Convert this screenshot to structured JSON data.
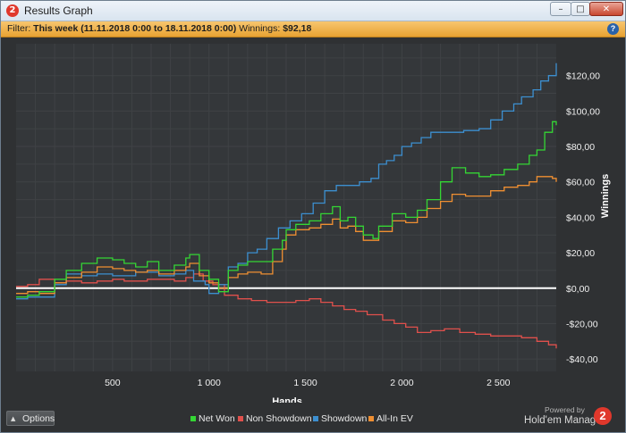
{
  "window": {
    "app_icon_glyph": "2",
    "title": "Results Graph",
    "controls": {
      "minimize": "–",
      "maximize": "□",
      "close": "✕"
    }
  },
  "filter": {
    "prefix": "Filter: ",
    "range": "This week (11.11.2018 0:00 to 18.11.2018 0:00)",
    "winnings_label": "  Winnings: ",
    "winnings_value": "$92,18",
    "help_icon": "?"
  },
  "colors": {
    "net_won": "#34d634",
    "non_showdown": "#e0504c",
    "showdown": "#3c8fd0",
    "all_in_ev": "#ef8f32",
    "zero_line": "#ffffff",
    "plot_bg": "#34373a",
    "filter_bar": "#f2b448"
  },
  "footer": {
    "options_caret": "▲",
    "options_label": "Options",
    "powered_by": "Powered by",
    "brand": "Hold'em Manager",
    "brand_logo": "2"
  },
  "chart_data": {
    "type": "line",
    "xlabel": "Hands",
    "ylabel": "Winnings",
    "xlim": [
      0,
      2800
    ],
    "ylim": [
      -47,
      138
    ],
    "x_ticks": [
      {
        "value": 500,
        "label": "500"
      },
      {
        "value": 1000,
        "label": "1 000"
      },
      {
        "value": 1500,
        "label": "1 500"
      },
      {
        "value": 2000,
        "label": "2 000"
      },
      {
        "value": 2500,
        "label": "2 500"
      }
    ],
    "y_ticks": [
      {
        "value": 120,
        "label": "$120,00"
      },
      {
        "value": 100,
        "label": "$100,00"
      },
      {
        "value": 80,
        "label": "$80,00"
      },
      {
        "value": 60,
        "label": "$60,00"
      },
      {
        "value": 40,
        "label": "$40,00"
      },
      {
        "value": 20,
        "label": "$20,00"
      },
      {
        "value": 0,
        "label": "$0,00"
      },
      {
        "value": -20,
        "label": "-$20,00"
      },
      {
        "value": -40,
        "label": "-$40,00"
      }
    ],
    "grid": true,
    "legend_position": "bottom",
    "series": [
      {
        "name": "Net Won",
        "x": [
          0,
          60,
          120,
          200,
          260,
          340,
          420,
          500,
          560,
          620,
          680,
          740,
          820,
          880,
          900,
          950,
          1000,
          1050,
          1100,
          1150,
          1200,
          1270,
          1330,
          1380,
          1400,
          1450,
          1520,
          1580,
          1640,
          1680,
          1720,
          1760,
          1800,
          1850,
          1880,
          1950,
          2020,
          2080,
          2130,
          2200,
          2260,
          2330,
          2400,
          2460,
          2530,
          2600,
          2660,
          2700,
          2740,
          2780,
          2800
        ],
        "y": [
          -5,
          -4,
          -2,
          5,
          10,
          14,
          17,
          16,
          14,
          12,
          15,
          10,
          13,
          17,
          19,
          10,
          5,
          -2,
          10,
          13,
          15,
          15,
          22,
          27,
          33,
          36,
          38,
          42,
          46,
          38,
          40,
          35,
          30,
          28,
          35,
          42,
          40,
          44,
          50,
          60,
          68,
          65,
          63,
          64,
          67,
          70,
          75,
          78,
          88,
          94,
          92
        ]
      },
      {
        "name": "Non Showdown",
        "x": [
          0,
          60,
          120,
          200,
          260,
          340,
          420,
          500,
          560,
          620,
          680,
          740,
          820,
          880,
          920,
          970,
          1020,
          1080,
          1150,
          1220,
          1300,
          1370,
          1450,
          1520,
          1580,
          1640,
          1700,
          1760,
          1820,
          1900,
          1960,
          2020,
          2080,
          2150,
          2220,
          2300,
          2380,
          2460,
          2540,
          2620,
          2700,
          2760,
          2800
        ],
        "y": [
          1,
          2,
          5,
          3,
          4,
          3,
          4,
          5,
          4,
          4,
          5,
          5,
          4,
          6,
          8,
          4,
          2,
          -4,
          -6,
          -7,
          -8,
          -8,
          -7,
          -6,
          -8,
          -10,
          -12,
          -13,
          -15,
          -18,
          -20,
          -22,
          -25,
          -24,
          -23,
          -25,
          -26,
          -27,
          -27,
          -28,
          -30,
          -32,
          -34
        ]
      },
      {
        "name": "Showdown",
        "x": [
          0,
          60,
          120,
          200,
          260,
          340,
          420,
          500,
          560,
          620,
          680,
          740,
          820,
          880,
          920,
          980,
          1000,
          1050,
          1100,
          1150,
          1200,
          1250,
          1300,
          1360,
          1420,
          1480,
          1540,
          1600,
          1660,
          1720,
          1780,
          1840,
          1880,
          1920,
          1960,
          2000,
          2050,
          2100,
          2150,
          2200,
          2260,
          2320,
          2400,
          2460,
          2520,
          2580,
          2620,
          2680,
          2720,
          2760,
          2800
        ],
        "y": [
          -6,
          -5,
          -5,
          2,
          8,
          7,
          8,
          7,
          7,
          9,
          9,
          7,
          8,
          10,
          4,
          2,
          -3,
          2,
          12,
          14,
          20,
          22,
          28,
          34,
          38,
          42,
          48,
          55,
          58,
          58,
          60,
          62,
          70,
          72,
          75,
          80,
          82,
          85,
          88,
          88,
          88,
          89,
          90,
          95,
          100,
          104,
          108,
          112,
          117,
          120,
          127
        ]
      },
      {
        "name": "All-In EV",
        "x": [
          0,
          60,
          120,
          200,
          260,
          340,
          420,
          500,
          560,
          620,
          680,
          740,
          820,
          880,
          900,
          950,
          1000,
          1050,
          1100,
          1150,
          1200,
          1270,
          1330,
          1380,
          1400,
          1450,
          1520,
          1580,
          1640,
          1680,
          1720,
          1760,
          1800,
          1850,
          1880,
          1950,
          2020,
          2080,
          2130,
          2200,
          2260,
          2330,
          2400,
          2460,
          2530,
          2600,
          2660,
          2700,
          2740,
          2780,
          2800
        ],
        "y": [
          -3,
          -2,
          -3,
          3,
          6,
          9,
          12,
          11,
          10,
          9,
          10,
          8,
          10,
          12,
          14,
          7,
          3,
          0,
          6,
          8,
          9,
          8,
          15,
          22,
          30,
          33,
          34,
          36,
          39,
          34,
          35,
          32,
          27,
          27,
          32,
          38,
          37,
          40,
          45,
          49,
          53,
          52,
          52,
          55,
          57,
          58,
          60,
          63,
          63,
          62,
          60
        ]
      }
    ]
  }
}
